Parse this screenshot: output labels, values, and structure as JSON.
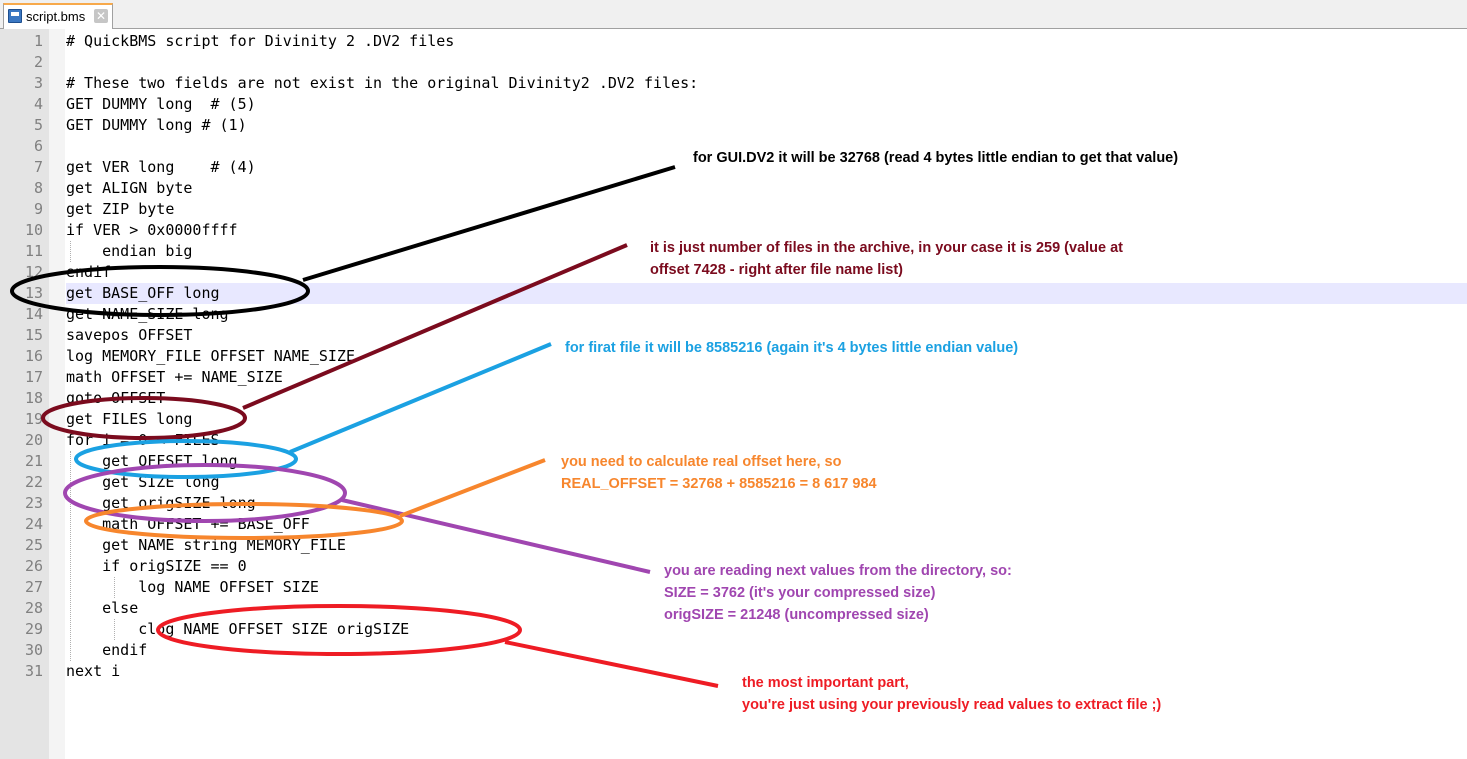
{
  "tab": {
    "label": "script.bms",
    "close_glyph": "✕",
    "icon": "save-file-icon"
  },
  "editor": {
    "current_line": 13,
    "lines": [
      {
        "n": "1",
        "text": "# QuickBMS script for Divinity 2 .DV2 files"
      },
      {
        "n": "2",
        "text": ""
      },
      {
        "n": "3",
        "text": "# These two fields are not exist in the original Divinity2 .DV2 files:"
      },
      {
        "n": "4",
        "text": "GET DUMMY long  # (5)"
      },
      {
        "n": "5",
        "text": "GET DUMMY long # (1)"
      },
      {
        "n": "6",
        "text": ""
      },
      {
        "n": "7",
        "text": "get VER long    # (4)"
      },
      {
        "n": "8",
        "text": "get ALIGN byte"
      },
      {
        "n": "9",
        "text": "get ZIP byte"
      },
      {
        "n": "10",
        "text": "if VER > 0x0000ffff"
      },
      {
        "n": "11",
        "text": "    endian big"
      },
      {
        "n": "12",
        "text": "endif"
      },
      {
        "n": "13",
        "text": "get BASE_OFF long"
      },
      {
        "n": "14",
        "text": "get NAME_SIZE long"
      },
      {
        "n": "15",
        "text": "savepos OFFSET"
      },
      {
        "n": "16",
        "text": "log MEMORY_FILE OFFSET NAME_SIZE"
      },
      {
        "n": "17",
        "text": "math OFFSET += NAME_SIZE"
      },
      {
        "n": "18",
        "text": "goto OFFSET"
      },
      {
        "n": "19",
        "text": "get FILES long"
      },
      {
        "n": "20",
        "text": "for i = 0 < FILES"
      },
      {
        "n": "21",
        "text": "    get OFFSET long"
      },
      {
        "n": "22",
        "text": "    get SIZE long"
      },
      {
        "n": "23",
        "text": "    get origSIZE long"
      },
      {
        "n": "24",
        "text": "    math OFFSET += BASE_OFF"
      },
      {
        "n": "25",
        "text": "    get NAME string MEMORY_FILE"
      },
      {
        "n": "26",
        "text": "    if origSIZE == 0"
      },
      {
        "n": "27",
        "text": "        log NAME OFFSET SIZE"
      },
      {
        "n": "28",
        "text": "    else"
      },
      {
        "n": "29",
        "text": "        clog NAME OFFSET SIZE origSIZE"
      },
      {
        "n": "30",
        "text": "    endif"
      },
      {
        "n": "31",
        "text": "next i"
      }
    ]
  },
  "annotations": {
    "base_off": {
      "color": "#000000",
      "lines": [
        "for GUI.DV2 it will be 32768   (read 4 bytes little endian to get that value)"
      ]
    },
    "files": {
      "color": "#7b0b1e",
      "lines": [
        "it is just number of files in the archive, in your case it is 259  (value at",
        "offset 7428 - right after file name list)"
      ]
    },
    "offset": {
      "color": "#1ba1e2",
      "lines": [
        "for firat file it will be 8585216  (again it's 4 bytes little endian value)"
      ]
    },
    "real_offset": {
      "color": "#f7862d",
      "lines": [
        "you need to calculate real offset here, so",
        "REAL_OFFSET = 32768 + 8585216 = 8 617 984"
      ]
    },
    "sizes": {
      "color": "#a046b0",
      "lines": [
        "you are reading next values from the directory, so:",
        "SIZE = 3762  (it's your compressed size)",
        "origSIZE = 21248 (uncompressed size)"
      ]
    },
    "clog": {
      "color": "#ee1c24",
      "lines": [
        "the most important part,",
        "you're just using your previously read values to extract file ;)"
      ]
    }
  }
}
